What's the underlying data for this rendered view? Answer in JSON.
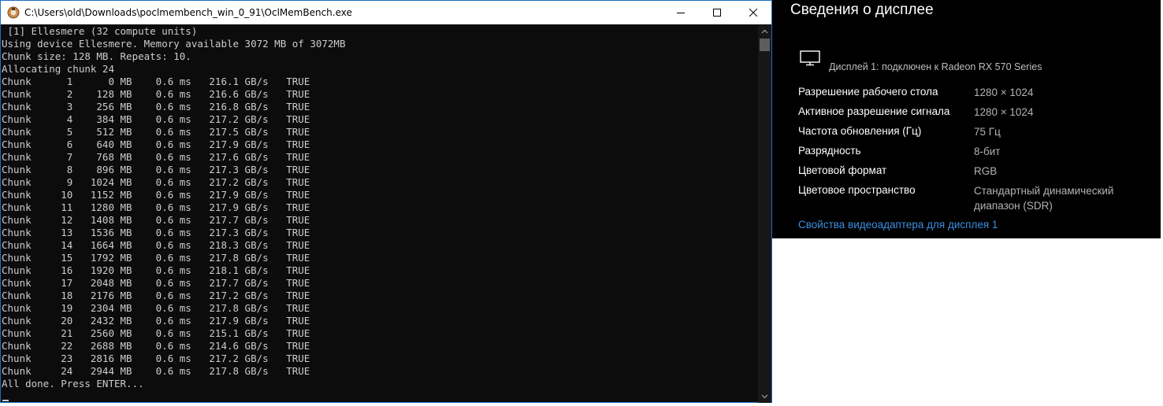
{
  "console": {
    "title": "C:\\Users\\old\\Downloads\\poclmembench_win_0_91\\OclMemBench.exe",
    "lines": [
      " [1] Ellesmere (32 compute units)",
      "Using device Ellesmere. Memory available 3072 MB of 3072MB",
      "Chunk size: 128 MB. Repeats: 10.",
      "Allocating chunk 24",
      "Chunk      1      0 MB    0.6 ms   216.1 GB/s   TRUE",
      "Chunk      2    128 MB    0.6 ms   216.6 GB/s   TRUE",
      "Chunk      3    256 MB    0.6 ms   216.8 GB/s   TRUE",
      "Chunk      4    384 MB    0.6 ms   217.2 GB/s   TRUE",
      "Chunk      5    512 MB    0.6 ms   217.5 GB/s   TRUE",
      "Chunk      6    640 MB    0.6 ms   217.9 GB/s   TRUE",
      "Chunk      7    768 MB    0.6 ms   217.6 GB/s   TRUE",
      "Chunk      8    896 MB    0.6 ms   217.3 GB/s   TRUE",
      "Chunk      9   1024 MB    0.6 ms   217.2 GB/s   TRUE",
      "Chunk     10   1152 MB    0.6 ms   217.9 GB/s   TRUE",
      "Chunk     11   1280 MB    0.6 ms   217.9 GB/s   TRUE",
      "Chunk     12   1408 MB    0.6 ms   217.7 GB/s   TRUE",
      "Chunk     13   1536 MB    0.6 ms   217.3 GB/s   TRUE",
      "Chunk     14   1664 MB    0.6 ms   218.3 GB/s   TRUE",
      "Chunk     15   1792 MB    0.6 ms   217.8 GB/s   TRUE",
      "Chunk     16   1920 MB    0.6 ms   218.1 GB/s   TRUE",
      "Chunk     17   2048 MB    0.6 ms   217.7 GB/s   TRUE",
      "Chunk     18   2176 MB    0.6 ms   217.2 GB/s   TRUE",
      "Chunk     19   2304 MB    0.6 ms   217.8 GB/s   TRUE",
      "Chunk     20   2432 MB    0.6 ms   217.9 GB/s   TRUE",
      "Chunk     21   2560 MB    0.6 ms   215.1 GB/s   TRUE",
      "Chunk     22   2688 MB    0.6 ms   214.6 GB/s   TRUE",
      "Chunk     23   2816 MB    0.6 ms   217.2 GB/s   TRUE",
      "Chunk     24   2944 MB    0.6 ms   217.8 GB/s   TRUE",
      "All done. Press ENTER..."
    ]
  },
  "display": {
    "title": "Сведения о дисплее",
    "display_name": "Дисплей 1: подключен к Radeon RX 570 Series",
    "properties": [
      {
        "label": "Разрешение рабочего стола",
        "value": "1280 × 1024"
      },
      {
        "label": "Активное разрешение сигнала",
        "value": "1280 × 1024"
      },
      {
        "label": "Частота обновления (Гц)",
        "value": "75 Гц"
      },
      {
        "label": "Разрядность",
        "value": "8-бит"
      },
      {
        "label": "Цветовой формат",
        "value": "RGB"
      },
      {
        "label": "Цветовое пространство",
        "value": "Стандартный динамический диапазон (SDR)"
      }
    ],
    "adapter_link": "Свойства видеоадаптера для дисплея 1"
  },
  "colors": {
    "console_bg": "#0c0c0c",
    "console_text": "#cccccc",
    "link": "#3d8ee0",
    "window_border": "#1f6fbf"
  },
  "icons": [
    "app-icon",
    "minimize-icon",
    "maximize-icon",
    "close-icon",
    "scroll-up-icon",
    "scroll-down-icon",
    "monitor-icon"
  ]
}
